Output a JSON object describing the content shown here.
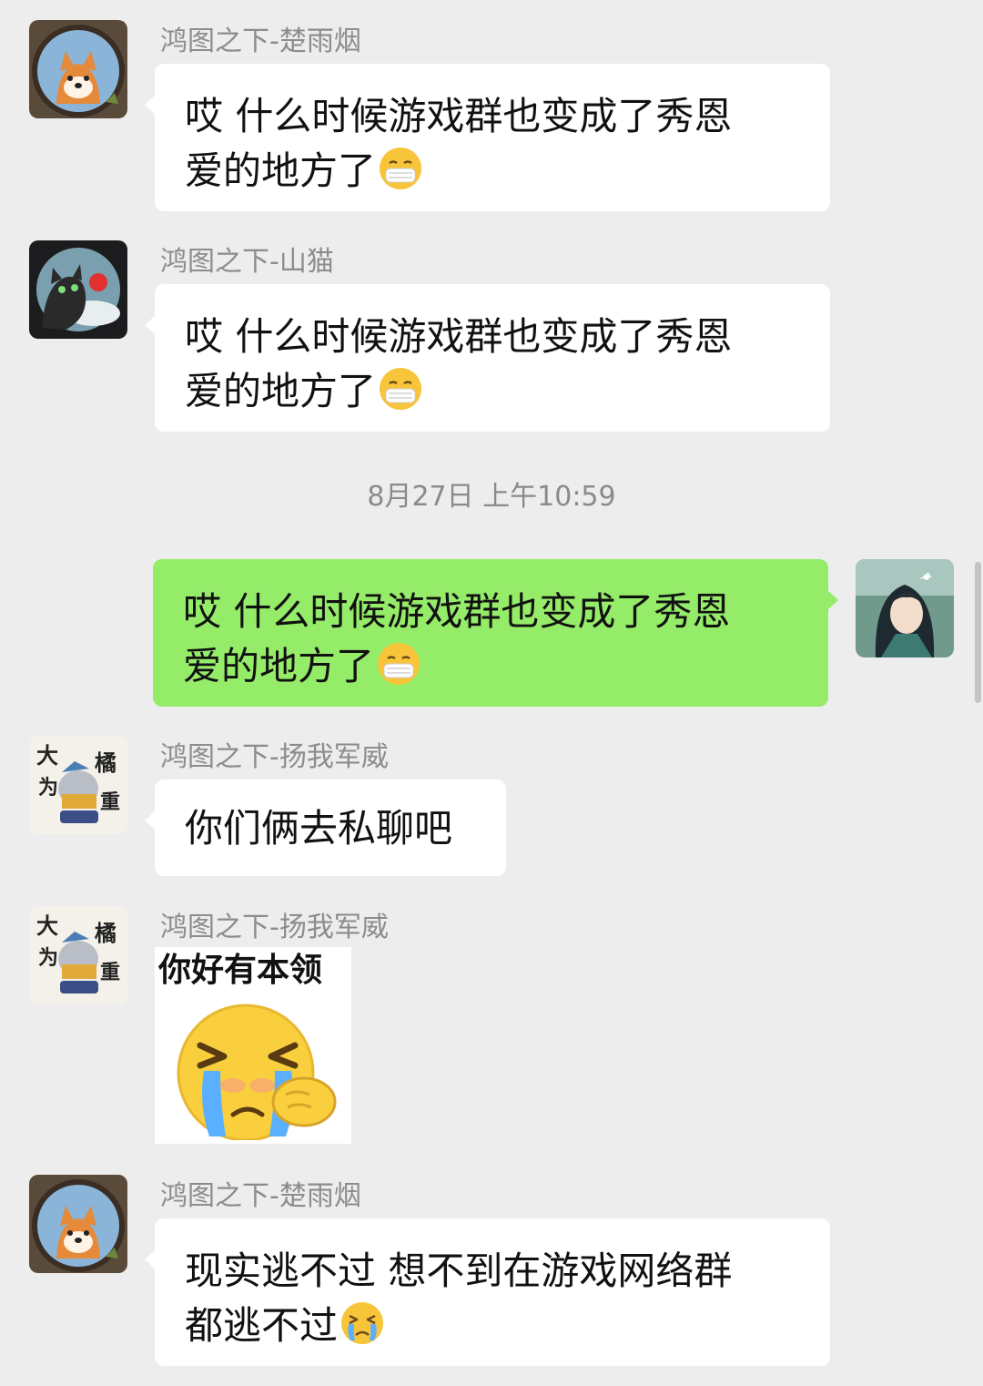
{
  "messages": [
    {
      "sender": "鸿图之下-楚雨烟",
      "line1": "哎  什么时候游戏群也变成了秀恩",
      "line2": "爱的地方了",
      "emoji": "mask-face-emoji"
    },
    {
      "sender": "鸿图之下-山猫",
      "line1": "哎  什么时候游戏群也变成了秀恩",
      "line2": "爱的地方了",
      "emoji": "mask-face-emoji"
    },
    {
      "sender": "鸿图之下-扬我军威",
      "text": "你们俩去私聊吧"
    },
    {
      "sender": "鸿图之下-扬我军威",
      "sticker_caption": "你好有本领",
      "sticker_icon": "crying-face-sticker"
    },
    {
      "sender": "鸿图之下-楚雨烟",
      "line1": "现实逃不过  想不到在游戏网络群",
      "line2": "都逃不过",
      "emoji": "crying-face-emoji"
    }
  ],
  "timestamp": "8月27日 上午10:59",
  "own_message": {
    "line1": "哎  什么时候游戏群也变成了秀恩",
    "line2": "爱的地方了",
    "emoji": "mask-face-emoji"
  },
  "avatar_lettering": {
    "big": "大",
    "orange": "橘",
    "wei": "为",
    "zhong": "重"
  },
  "colors": {
    "background": "#ededed",
    "bubble_incoming": "#ffffff",
    "bubble_outgoing": "#95ec69",
    "sender_name": "#8c8c8c",
    "timestamp": "#8a8a8a"
  }
}
